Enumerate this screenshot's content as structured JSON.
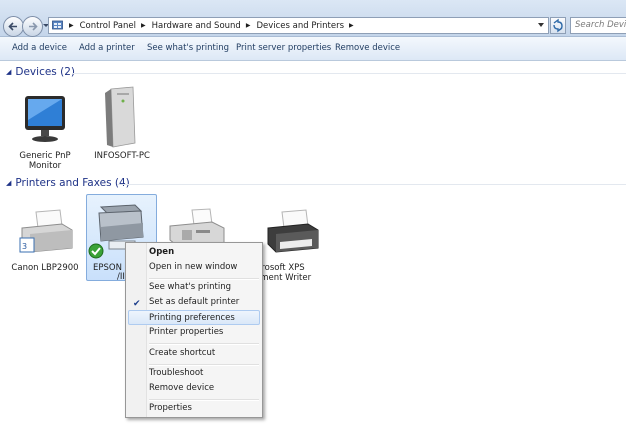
{
  "address_bar": {
    "breadcrumbs": [
      "Control Panel",
      "Hardware and Sound",
      "Devices and Printers"
    ],
    "search_placeholder": "Search Devices and Printers"
  },
  "toolbar": {
    "add_device": "Add a device",
    "add_printer": "Add a printer",
    "see_printing": "See what's printing",
    "print_server": "Print server properties",
    "remove_device": "Remove device"
  },
  "devices_group": {
    "header": "Devices (2)",
    "items": [
      {
        "label_line1": "Generic PnP",
        "label_line2": "Monitor",
        "icon": "monitor-icon"
      },
      {
        "label_line1": "INFOSOFT-PC",
        "label_line2": "",
        "icon": "computer-tower-icon"
      }
    ]
  },
  "printers_group": {
    "header": "Printers and Faxes (4)",
    "items": [
      {
        "label_line1": "Canon LBP2900",
        "label_line2": "",
        "icon": "printer-icon"
      },
      {
        "label_line1": "EPSON L",
        "label_line2": "/II",
        "icon": "multifunction-printer-icon",
        "selected": true,
        "default": true
      },
      {
        "label_line1": "",
        "label_line2": "",
        "icon": "fax-icon"
      },
      {
        "label_line1": "rosoft XPS",
        "label_line2": "ument Writer",
        "icon": "printer-icon"
      }
    ]
  },
  "context_menu": {
    "open": "Open",
    "open_new_window": "Open in new window",
    "see_printing": "See what's printing",
    "set_default": "Set as default printer",
    "printing_preferences": "Printing preferences",
    "printer_properties": "Printer properties",
    "create_shortcut": "Create shortcut",
    "troubleshoot": "Troubleshoot",
    "remove_device": "Remove device",
    "properties": "Properties"
  },
  "colors": {
    "group_header": "#1e3287",
    "selection_fill": "#c9e0fb",
    "selection_border": "#84acdd",
    "menu_highlight_border": "#aecbf0"
  }
}
